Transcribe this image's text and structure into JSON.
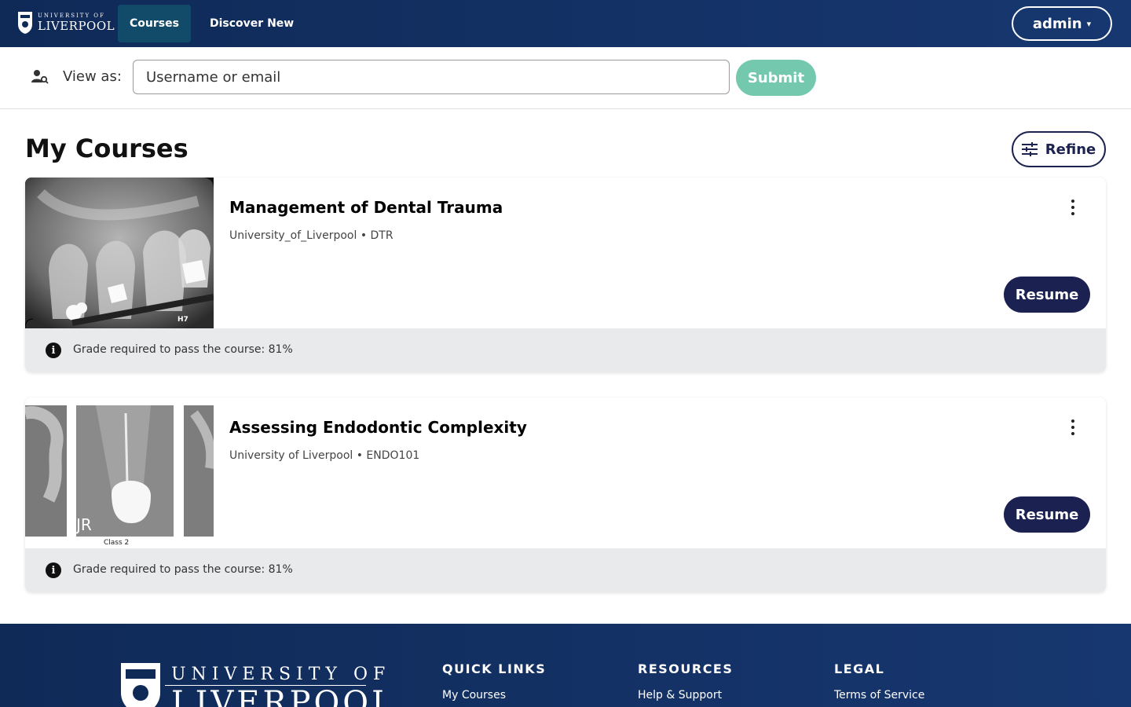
{
  "header": {
    "logo": {
      "line1": "UNIVERSITY OF",
      "line2": "LIVERPOOL"
    },
    "tabs": [
      {
        "label": "Courses",
        "active": true
      },
      {
        "label": "Discover New",
        "active": false
      }
    ],
    "user_menu": {
      "label": "admin",
      "icon": "chevron-down-icon"
    }
  },
  "view_as": {
    "label": "View as:",
    "icon": "user-search-icon",
    "input_placeholder": "Username or email",
    "input_value": "",
    "submit_label": "Submit"
  },
  "main": {
    "title": "My Courses",
    "refine_label": "Refine",
    "courses": [
      {
        "title": "Management of Dental Trauma",
        "subtitle": "University_of_Liverpool • DTR",
        "thumbnail_text": "H7",
        "resume_label": "Resume",
        "grade_text": "Grade required to pass the course: 81%"
      },
      {
        "title": "Assessing Endodontic Complexity",
        "subtitle": "University of Liverpool • ENDO101",
        "thumbnail_text": "JR",
        "thumbnail_caption": "Class 2",
        "resume_label": "Resume",
        "grade_text": "Grade required to pass the course: 81%"
      }
    ]
  },
  "footer": {
    "logo": {
      "line1": "UNIVERSITY OF",
      "line2": "LIVERPOOL"
    },
    "columns": [
      {
        "heading": "QUICK LINKS",
        "links": [
          "My Courses"
        ]
      },
      {
        "heading": "RESOURCES",
        "links": [
          "Help & Support"
        ]
      },
      {
        "heading": "LEGAL",
        "links": [
          "Terms of Service"
        ]
      }
    ]
  },
  "colors": {
    "header_bg": "#0f2a57",
    "active_tab": "#124b6a",
    "submit": "#73c8ae",
    "resume": "#1b2150",
    "grade_bar": "#e9eaec"
  }
}
